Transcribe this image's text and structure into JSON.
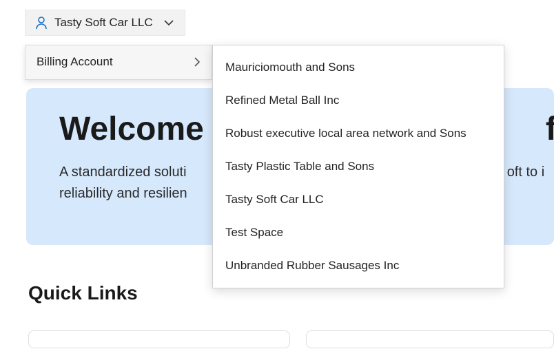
{
  "account": {
    "selected": "Tasty Soft Car LLC"
  },
  "submenu": {
    "label": "Billing Account"
  },
  "billingAccounts": [
    "Mauriciomouth and Sons",
    "Refined Metal Ball Inc",
    "Robust executive local area network and Sons",
    "Tasty Plastic Table and Sons",
    "Tasty Soft Car LLC",
    "Test Space",
    "Unbranded Rubber Sausages Inc"
  ],
  "hero": {
    "title_prefix": "Welcome t",
    "title_suffix": "fany",
    "sub_line1_prefix": "A standardized soluti",
    "sub_line1_suffix": "oft to i",
    "sub_line2": "reliability and resilien"
  },
  "section": {
    "heading": "Quick Links"
  }
}
